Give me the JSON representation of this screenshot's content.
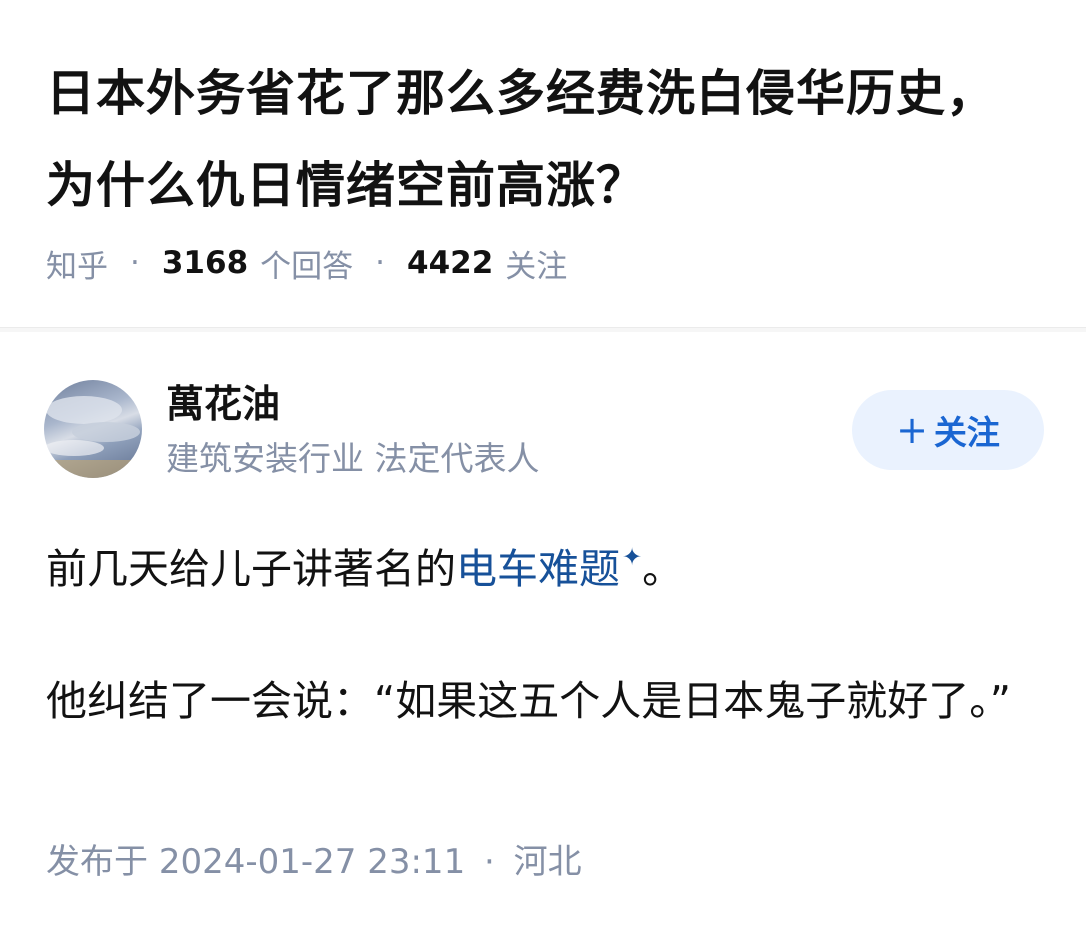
{
  "question": {
    "title": "日本外务省花了那么多经费洗白侵华历史，为什么仇日情绪空前高涨？",
    "source": "知乎",
    "answer_count": "3168",
    "answer_label": "个回答",
    "follower_count": "4422",
    "follower_label": "关注"
  },
  "author": {
    "name": "萬花油",
    "headline": "建筑安装行业  法定代表人",
    "follow_label": "关注",
    "follow_plus": "+"
  },
  "answer": {
    "para1_before": "前几天给儿子讲著名的",
    "para1_link": "电车难题",
    "para1_link_mark": "✦",
    "para1_after": "。",
    "para2": "他纠结了一会说：“如果这五个人是日本鬼子就好了。”"
  },
  "meta": {
    "publish_label": "发布于",
    "publish_time": "2024-01-27  23:11",
    "location_sep": "·",
    "location": "河北"
  },
  "colors": {
    "link": "#175199",
    "muted": "#8590a6",
    "follow_bg": "#eaf2fe",
    "follow_text": "#1a66d2"
  }
}
